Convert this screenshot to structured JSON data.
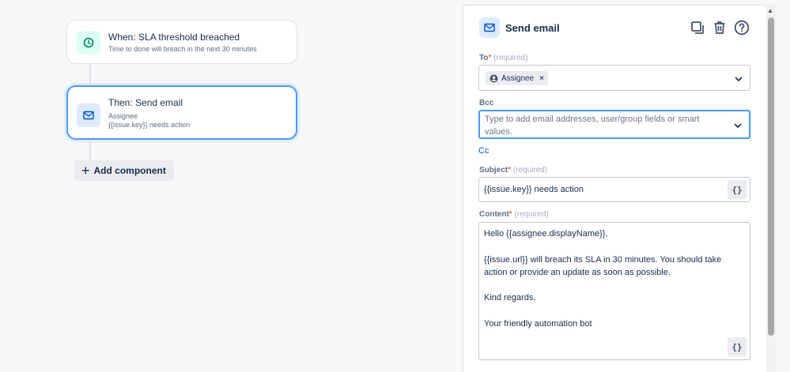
{
  "flow": {
    "trigger": {
      "title": "When: SLA threshold breached",
      "subtitle": "Time to done will breach in the next 30 minutes",
      "icon": "clock-icon"
    },
    "action": {
      "title": "Then: Send email",
      "line1": "Assignee",
      "line2": "{{issue.key}} needs action",
      "icon": "mail-icon"
    },
    "add_component_label": "Add component"
  },
  "panel": {
    "title": "Send email",
    "actions": [
      "copy-icon",
      "trash-icon",
      "help-icon"
    ],
    "to": {
      "label": "To",
      "required_mark": "*",
      "hint": "(required)",
      "chips": [
        "Assignee"
      ]
    },
    "bcc": {
      "label": "Bcc",
      "placeholder": "Type to add email addresses, user/group fields or smart values."
    },
    "cc_link": "Cc",
    "subject": {
      "label": "Subject",
      "required_mark": "*",
      "hint": "(required)",
      "value": "{{issue.key}} needs action",
      "smart_button": "{}"
    },
    "content": {
      "label": "Content",
      "required_mark": "*",
      "hint": "(required)",
      "lines": [
        "Hello {{assignee.displayName}},",
        "",
        " {{issue.url}} will breach its SLA in 30 minutes. You should take action or provide an update as soon as possible.",
        "",
        "Kind regards,",
        "",
        "Your friendly automation bot"
      ],
      "smart_button": "{}"
    }
  },
  "colors": {
    "accent": "#0052cc",
    "focus": "#4c9aff",
    "trigger_icon": "#00875a",
    "required": "#de350b"
  }
}
